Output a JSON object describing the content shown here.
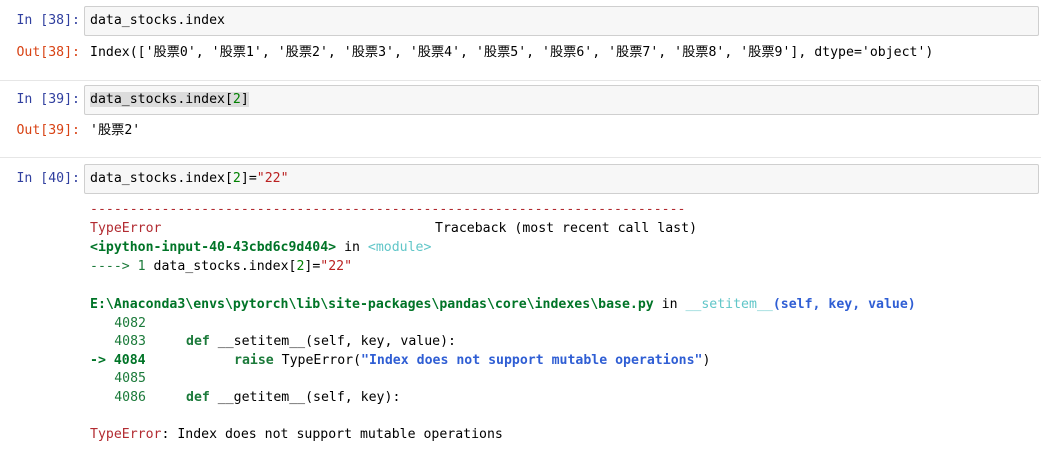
{
  "cells": [
    {
      "in_prompt": "In  [38]:",
      "code": "data_stocks.index",
      "out_prompt": "Out[38]:",
      "output": "Index(['股票0', '股票1', '股票2', '股票3', '股票4', '股票5', '股票6', '股票7', '股票8', '股票9'], dtype='object')"
    },
    {
      "in_prompt": "In  [39]:",
      "code_prefix": "data_stocks.index[",
      "code_num": "2",
      "code_suffix": "]",
      "out_prompt": "Out[39]:",
      "output": "'股票2'"
    },
    {
      "in_prompt": "In  [40]:",
      "code_prefix": "data_stocks.index[",
      "code_num": "2",
      "code_mid": "]=",
      "code_str": "\"22\""
    }
  ],
  "traceback": {
    "dashes": "---------------------------------------------------------------------------",
    "error_type": "TypeError",
    "traceback_label": "Traceback (most recent call last)",
    "input_ref": "<ipython-input-40-43cbd6c9d404>",
    "in_word": " in ",
    "module": "<module>",
    "arrow_line_prefix": "----> 1 ",
    "arrow_code_prefix": "data_stocks.index[",
    "arrow_code_num": "2",
    "arrow_code_mid": "]=",
    "arrow_code_str": "\"22\"",
    "file_path": "E:\\Anaconda3\\envs\\pytorch\\lib\\site-packages\\pandas\\core\\indexes\\base.py",
    "file_in": " in ",
    "func_name": "__setitem__",
    "func_args": "(self, key, value)",
    "lines": [
      {
        "no": "4082",
        "text": ""
      },
      {
        "no": "4083",
        "kw": "def",
        "text": " __setitem__(self, key, value):"
      },
      {
        "no": "-> 4084",
        "kw": "raise",
        "text_prefix": " TypeError(",
        "text_str": "\"Index does not support mutable operations\"",
        "text_suffix": ")"
      },
      {
        "no": "4085",
        "text": ""
      },
      {
        "no": "4086",
        "kw": "def",
        "text": " __getitem__(self, key):"
      }
    ],
    "final_type": "TypeError",
    "final_msg": ": Index does not support mutable operations"
  }
}
